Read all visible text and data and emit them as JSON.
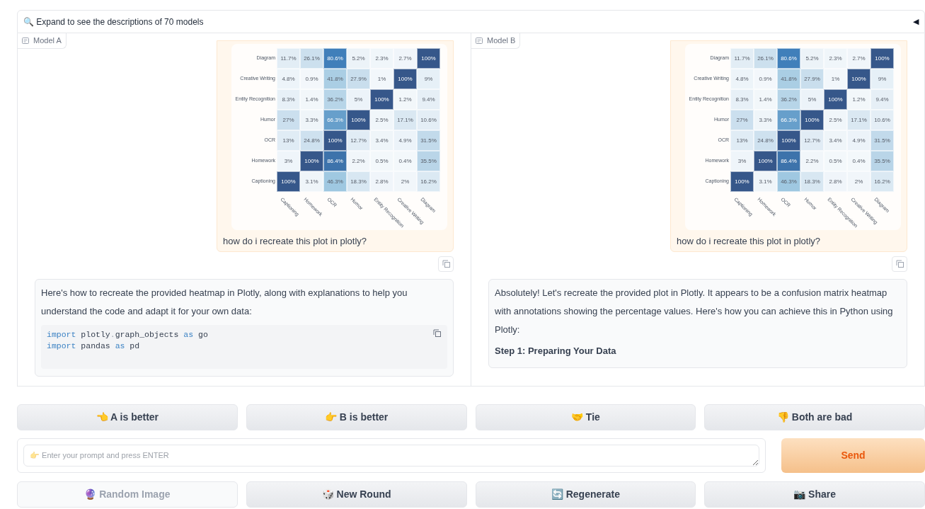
{
  "accordion": {
    "label": "🔍 Expand to see the descriptions of 70 models",
    "toggle": "◀"
  },
  "panels": [
    {
      "label": "Model A",
      "message": {
        "heatmap": {
          "rows": [
            "Diagram",
            "Creative Writing",
            "Entity Recognition",
            "Humor",
            "OCR",
            "Homework",
            "Captioning"
          ],
          "columns": [
            "Captioning",
            "Homework",
            "OCR",
            "Humor",
            "Entity Recognition",
            "Creative Writing",
            "Diagram"
          ],
          "cells": [
            [
              "11.7%",
              "26.1%",
              "80.6%",
              "5.2%",
              "2.3%",
              "2.7%",
              "100%"
            ],
            [
              "4.8%",
              "0.9%",
              "41.8%",
              "27.9%",
              "1%",
              "100%",
              "9%"
            ],
            [
              "8.3%",
              "1.4%",
              "36.2%",
              "5%",
              "100%",
              "1.2%",
              "9.4%"
            ],
            [
              "27%",
              "3.3%",
              "66.3%",
              "100%",
              "2.5%",
              "17.1%",
              "10.6%"
            ],
            [
              "13%",
              "24.8%",
              "100%",
              "12.7%",
              "3.4%",
              "4.9%",
              "31.5%"
            ],
            [
              "3%",
              "100%",
              "86.4%",
              "2.2%",
              "0.5%",
              "0.4%",
              "35.5%"
            ],
            [
              "100%",
              "3.1%",
              "46.3%",
              "18.3%",
              "2.8%",
              "2%",
              "16.2%"
            ]
          ]
        },
        "text": "how do i recreate this plot in plotly?"
      },
      "reply": [
        {
          "kind": "paragraph",
          "text": "Here's how to recreate the provided heatmap in Plotly, along with explanations to help you understand the code and adapt it for your own data:"
        },
        {
          "kind": "code",
          "lines": [
            [
              {
                "kind": "keyword",
                "text": "import"
              },
              {
                "kind": "plain",
                "text": " plotly"
              },
              {
                "kind": "punct",
                "text": "."
              },
              {
                "kind": "plain",
                "text": "graph_objects "
              },
              {
                "kind": "keyword",
                "text": "as"
              },
              {
                "kind": "plain",
                "text": " go"
              }
            ],
            [
              {
                "kind": "keyword",
                "text": "import"
              },
              {
                "kind": "plain",
                "text": " pandas "
              },
              {
                "kind": "keyword",
                "text": "as"
              },
              {
                "kind": "plain",
                "text": " pd"
              }
            ]
          ]
        }
      ]
    },
    {
      "label": "Model B",
      "message": {
        "heatmap": {
          "rows": [
            "Diagram",
            "Creative Writing",
            "Entity Recognition",
            "Humor",
            "OCR",
            "Homework",
            "Captioning"
          ],
          "columns": [
            "Captioning",
            "Homework",
            "OCR",
            "Humor",
            "Entity Recognition",
            "Creative Writing",
            "Diagram"
          ],
          "cells": [
            [
              "11.7%",
              "26.1%",
              "80.6%",
              "5.2%",
              "2.3%",
              "2.7%",
              "100%"
            ],
            [
              "4.8%",
              "0.9%",
              "41.8%",
              "27.9%",
              "1%",
              "100%",
              "9%"
            ],
            [
              "8.3%",
              "1.4%",
              "36.2%",
              "5%",
              "100%",
              "1.2%",
              "9.4%"
            ],
            [
              "27%",
              "3.3%",
              "66.3%",
              "100%",
              "2.5%",
              "17.1%",
              "10.6%"
            ],
            [
              "13%",
              "24.8%",
              "100%",
              "12.7%",
              "3.4%",
              "4.9%",
              "31.5%"
            ],
            [
              "3%",
              "100%",
              "86.4%",
              "2.2%",
              "0.5%",
              "0.4%",
              "35.5%"
            ],
            [
              "100%",
              "3.1%",
              "46.3%",
              "18.3%",
              "2.8%",
              "2%",
              "16.2%"
            ]
          ]
        },
        "text": "how do i recreate this plot in plotly?"
      },
      "reply": [
        {
          "kind": "paragraph",
          "text": "Absolutely! Let's recreate the provided plot in Plotly. It appears to be a confusion matrix heatmap with annotations showing the percentage values. Here's how you can achieve this in Python using Plotly:"
        },
        {
          "kind": "heading",
          "text": "Step 1: Preparing Your Data"
        }
      ]
    }
  ],
  "vote_buttons": [
    "👈 A is better",
    "👉 B is better",
    "🤝 Tie",
    "👎 Both are bad"
  ],
  "prompt": {
    "placeholder": "👉 Enter your prompt and press ENTER"
  },
  "send_button": "Send",
  "action_buttons": [
    {
      "label": "🔮 Random Image",
      "disabled": true
    },
    {
      "label": "🎲 New Round",
      "disabled": false
    },
    {
      "label": "🔄 Regenerate",
      "disabled": false
    },
    {
      "label": "📷 Share",
      "disabled": false
    }
  ]
}
